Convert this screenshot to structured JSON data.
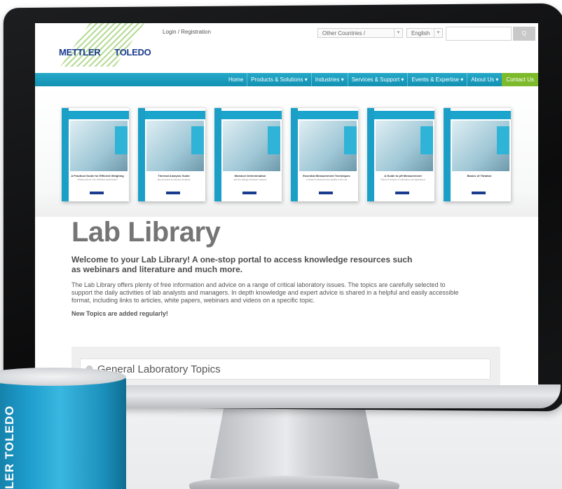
{
  "header": {
    "logo_word1": "METTLER",
    "logo_word2": "TOLEDO",
    "login_link": "Login / Registration",
    "country_select": "Other Countries /",
    "language_select": "English",
    "search_placeholder": "",
    "search_button": "Q"
  },
  "nav": {
    "items": [
      {
        "label": "Home"
      },
      {
        "label": "Products & Solutions ▾"
      },
      {
        "label": "Industries ▾"
      },
      {
        "label": "Services & Support ▾"
      },
      {
        "label": "Events & Expertise ▾"
      },
      {
        "label": "About Us ▾"
      }
    ],
    "contact": "Contact Us"
  },
  "books": [
    {
      "title": "A Practical Guide for Efficient Weighing",
      "sub": "Thinking About Your Workflow Optimization"
    },
    {
      "title": "Thermal Analysis Guide",
      "sub": "Tips and Hints for Routine Analyses"
    },
    {
      "title": "Moisture Determination",
      "sub": "with the Halogen Moisture Analyzer"
    },
    {
      "title": "Essential Measurement Techniques",
      "sub": "A Guide for Measurement Quality in the Lab"
    },
    {
      "title": "A Guide to pH Measurement",
      "sub": "Theory & Practice of Laboratory pH Applications"
    },
    {
      "title": "Basics of Titration",
      "sub": ""
    }
  ],
  "main": {
    "title": "Lab Library",
    "intro": "Welcome to your Lab Library! A one-stop portal to access knowledge resources such as webinars and literature and much more.",
    "body": "The Lab Library offers plenty of free information and advice on a range of critical laboratory issues. The topics are carefully selected to support the daily activities of lab analysts and managers. In depth knowledge and expert advice is shared in a helpful and easily accessible format, including links to articles, white papers, webinars and videos on a specific topic.",
    "new_topics": "New Topics are added regularly!"
  },
  "topics": [
    {
      "label": "General Laboratory Topics"
    }
  ],
  "mug": {
    "brand": "LER TOLEDO"
  },
  "colors": {
    "nav_blue": "#1a9fc2",
    "contact_green": "#7dbb2c",
    "logo_navy": "#1a3c8e",
    "mug_blue": "#1f9fcf"
  }
}
